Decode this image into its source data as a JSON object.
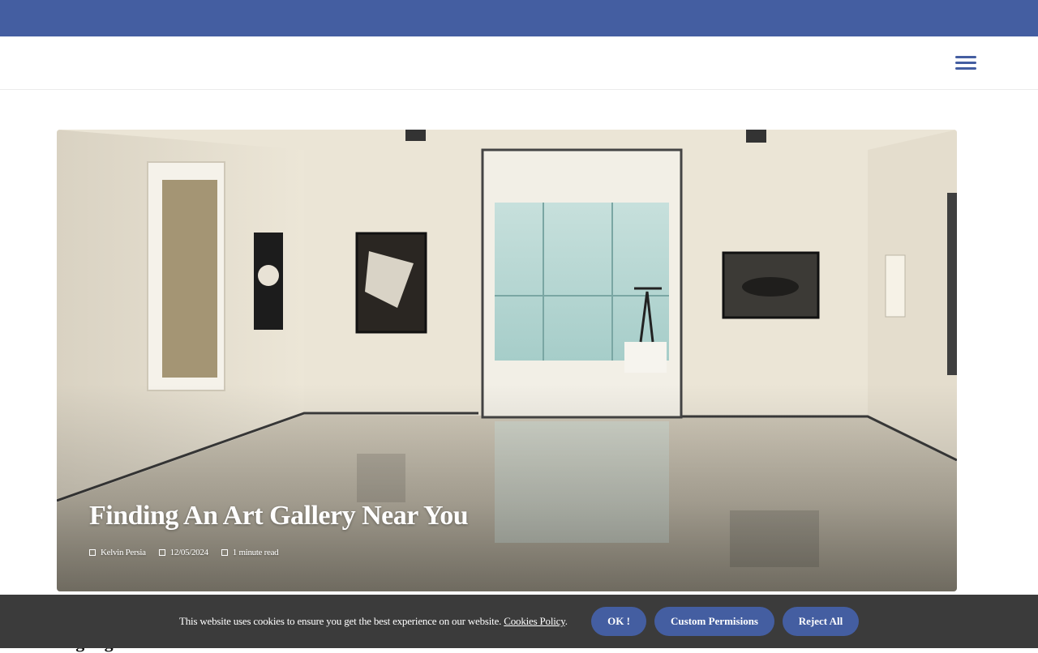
{
  "header": {
    "menu_icon": "hamburger-menu-icon"
  },
  "hero": {
    "image_icon": "art-gallery-photo",
    "title": "Finding An Art Gallery Near You",
    "meta": {
      "author": "Kelvin Persia",
      "date": "12/05/2024",
      "read_time": "1 minute read",
      "author_icon": "user-icon",
      "date_icon": "calendar-icon",
      "read_time_icon": "clock-icon"
    }
  },
  "section": {
    "heading": "Highlights"
  },
  "cookie_banner": {
    "message": "This website uses cookies to ensure you get the best experience on our website.",
    "policy_link": "Cookies Policy",
    "period": ".",
    "ok_button": "OK !",
    "custom_button": "Custom Permisions",
    "reject_button": "Reject All"
  },
  "colors": {
    "brand": "#445ea1",
    "cookie_bg": "#3b3b3b"
  }
}
